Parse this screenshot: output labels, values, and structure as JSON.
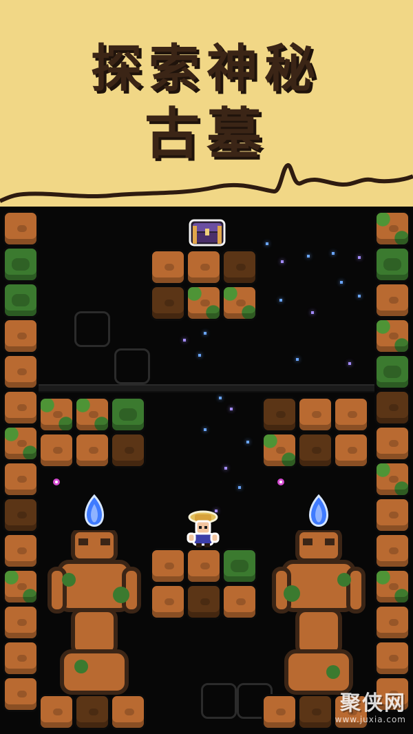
{
  "banner": {
    "line1": "探索神秘",
    "line2": "古墓",
    "bg_color": "#f1d786",
    "text_color": "#3b2516"
  },
  "watermark": {
    "main": "聚侠网",
    "sub": "www.juxia.com"
  },
  "colors": {
    "tile_light": "#b96a31",
    "tile_dark": "#5b3516",
    "moss": "#3b7a2f",
    "sparkle_blue": "#6aa6ff",
    "sparkle_purple": "#a48cff",
    "flame_blue": "#3f7bff"
  },
  "sprites": {
    "chest_icon": "treasure-chest-icon",
    "player_icon": "explorer-player-icon",
    "torch_icon": "blue-flame-torch-icon",
    "statue_icon": "guardian-statue-icon"
  }
}
